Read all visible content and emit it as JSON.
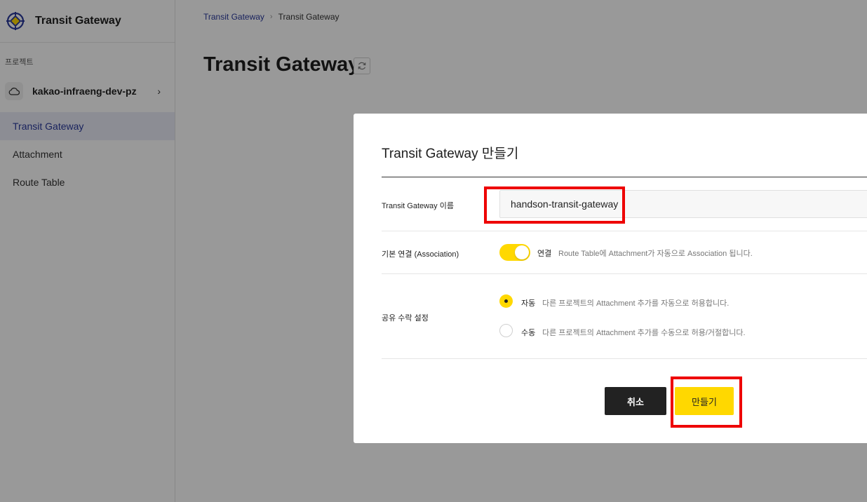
{
  "sidebar": {
    "brand_title": "Transit Gateway",
    "section_label": "프로젝트",
    "project_name": "kakao-infraeng-dev-pz",
    "nav_items": [
      {
        "label": "Transit Gateway",
        "active": true
      },
      {
        "label": "Attachment",
        "active": false
      },
      {
        "label": "Route Table",
        "active": false
      }
    ]
  },
  "breadcrumb": {
    "parent": "Transit Gateway",
    "current": "Transit Gateway"
  },
  "page": {
    "title": "Transit Gateway"
  },
  "modal": {
    "title": "Transit Gateway 만들기",
    "name_field": {
      "label": "Transit Gateway 이름",
      "value": "handson-transit-gateway"
    },
    "association": {
      "label": "기본 연결 (Association)",
      "state_label": "연결",
      "description": "Route Table에 Attachment가 자동으로 Association 됩니다.",
      "enabled": true
    },
    "share_acceptance": {
      "label": "공유 수락 설정",
      "options": [
        {
          "label": "자동",
          "description": "다른 프로젝트의 Attachment 추가를 자동으로 허용합니다.",
          "selected": true
        },
        {
          "label": "수동",
          "description": "다른 프로젝트의 Attachment 추가를 수동으로 허용/거절합니다.",
          "selected": false
        }
      ]
    },
    "cancel_label": "취소",
    "create_label": "만들기"
  },
  "colors": {
    "accent": "#ffd800",
    "nav_active_text": "#2a3a9c",
    "highlight": "#ee0000"
  }
}
